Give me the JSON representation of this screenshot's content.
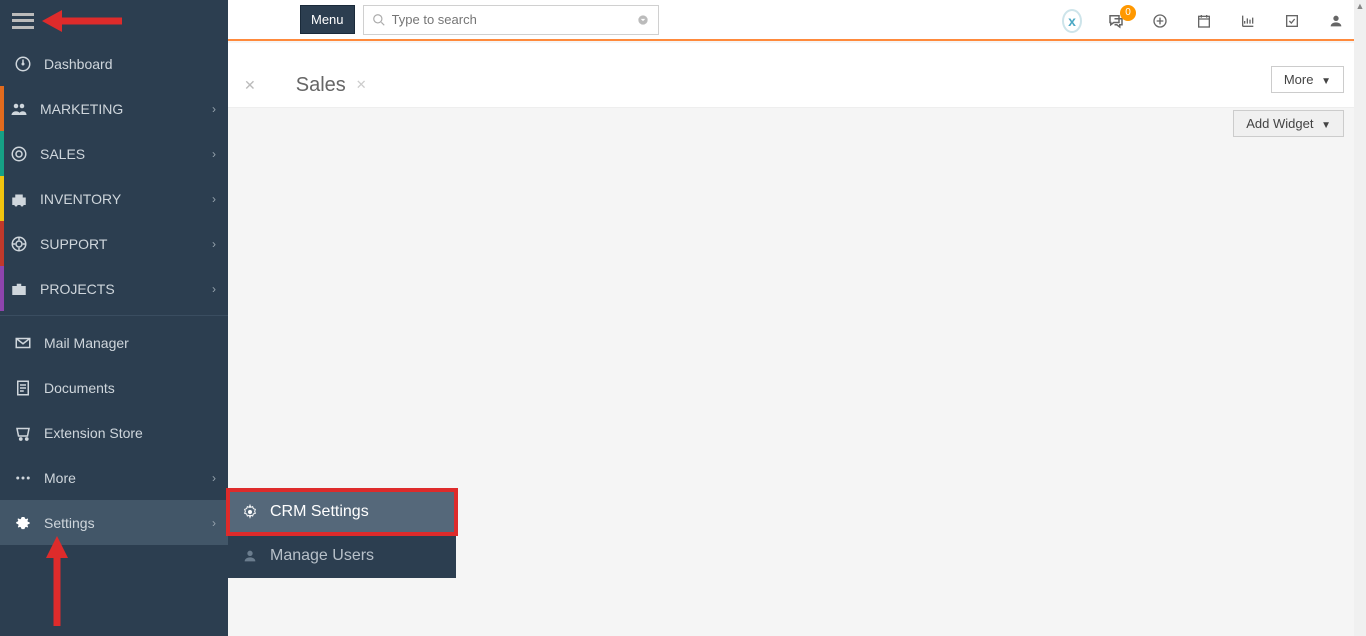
{
  "topbar": {
    "menu_label": "Menu",
    "search_placeholder": "Type to search",
    "notif_count": "0"
  },
  "sidebar": {
    "dashboard": "Dashboard",
    "marketing": "MARKETING",
    "sales": "SALES",
    "inventory": "INVENTORY",
    "support": "SUPPORT",
    "projects": "PROJECTS",
    "mail_manager": "Mail Manager",
    "documents": "Documents",
    "extension_store": "Extension Store",
    "more": "More",
    "settings": "Settings"
  },
  "submenu": {
    "crm_settings": "CRM Settings",
    "manage_users": "Manage Users"
  },
  "main": {
    "title": "Sales",
    "more_label": "More",
    "add_widget_label": "Add Widget"
  }
}
